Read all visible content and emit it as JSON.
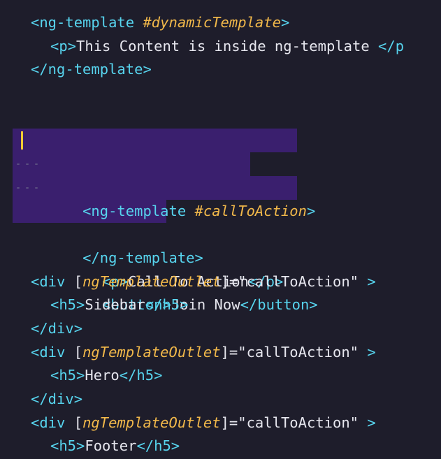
{
  "editor": {
    "colors": {
      "background": "#1e1d2b",
      "tag": "#57d4ee",
      "reference": "#f1b84a",
      "text": "#e6e6ee",
      "selection": "#3a1f6e",
      "cursor": "#ffcc33"
    },
    "lines": {
      "l1": {
        "open": "<ng-template ",
        "ref": "#dynamicTemplate",
        "close": ">"
      },
      "l2": {
        "open": "<p>",
        "text": "This Content is inside ng-template ",
        "close": "</p"
      },
      "l3": {
        "close": "</ng-template>"
      },
      "l6": {
        "open": "<ng-template ",
        "ref": "#callToAction",
        "close": ">"
      },
      "l7": {
        "open": "<p>",
        "text": "Call To Action",
        "close": "</p>"
      },
      "l8": {
        "open": "<button>",
        "text": "Join Now",
        "close": "</button>"
      },
      "l9": {
        "close": "</ng-template>"
      },
      "l12": {
        "open": "<div ",
        "bo": "[",
        "attr": "ngTemplateOutlet",
        "bc": "]=",
        "val": "\"callToAction\"",
        "close": " >"
      },
      "l13": {
        "open": "<h5>",
        "text": "Sidebar",
        "close": "</h5>"
      },
      "l14": {
        "close": "</div>"
      },
      "l15": {
        "open": "<div ",
        "bo": "[",
        "attr": "ngTemplateOutlet",
        "bc": "]=",
        "val": "\"callToAction\"",
        "close": " >"
      },
      "l16": {
        "open": "<h5>",
        "text": "Hero",
        "close": "</h5>"
      },
      "l17": {
        "close": "</div>"
      },
      "l18": {
        "open": "<div ",
        "bo": "[",
        "attr": "ngTemplateOutlet",
        "bc": "]=",
        "val": "\"callToAction\"",
        "close": " >"
      },
      "l19": {
        "open": "<h5>",
        "text": "Footer",
        "close": "</h5>"
      }
    }
  }
}
